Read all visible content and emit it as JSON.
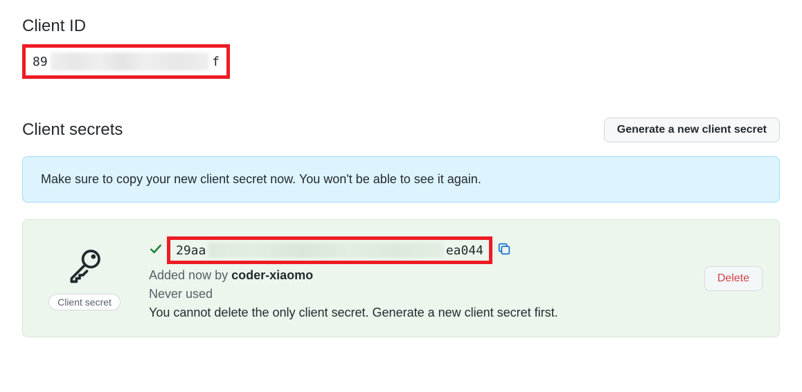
{
  "clientId": {
    "heading": "Client ID",
    "prefix": "89",
    "suffix": "f"
  },
  "clientSecrets": {
    "heading": "Client secrets",
    "generateBtn": "Generate a new client secret",
    "infoBanner": "Make sure to copy your new client secret now. You won't be able to see it again.",
    "secret": {
      "badge": "Client secret",
      "valuePrefix": "29aa",
      "valueSuffix": "ea044",
      "addedPrefix": "Added now by ",
      "addedBy": "coder-xiaomo",
      "status": "Never used",
      "hint": "You cannot delete the only client secret. Generate a new client secret first."
    },
    "deleteBtn": "Delete"
  }
}
